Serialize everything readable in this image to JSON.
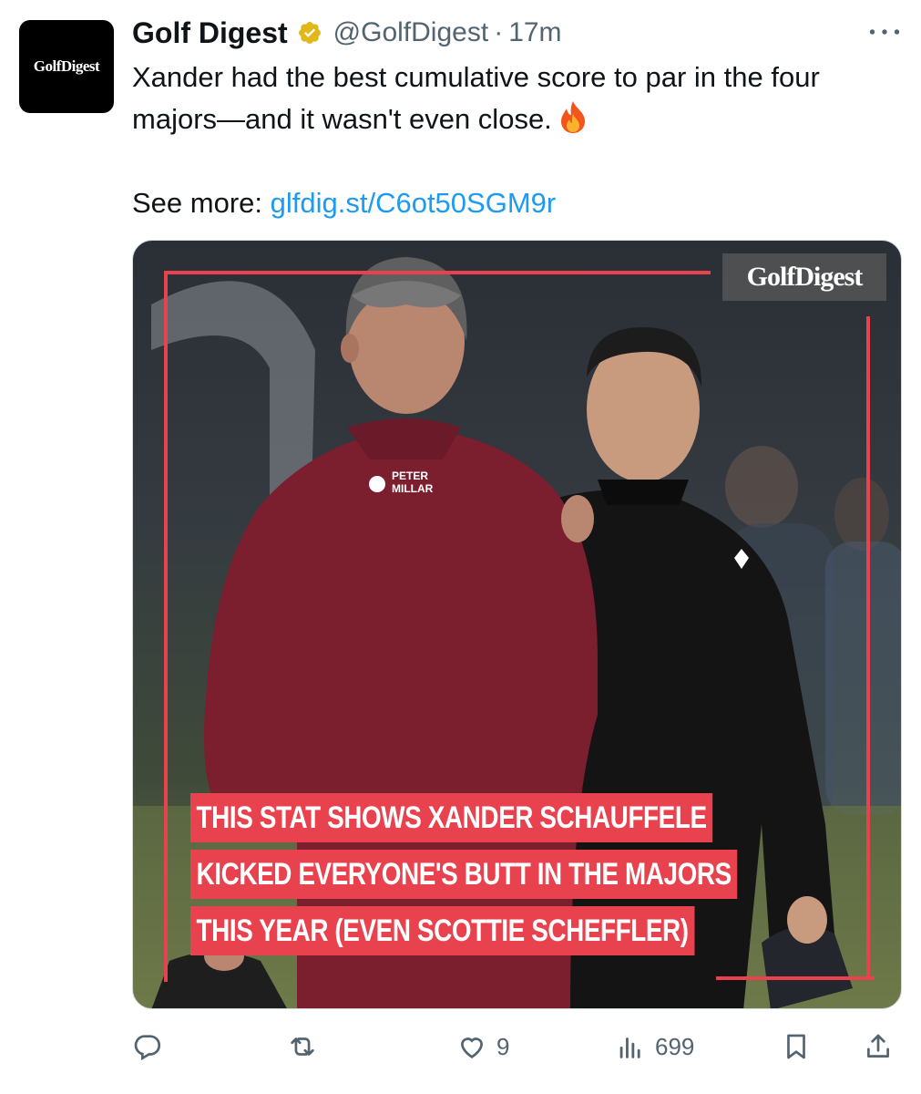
{
  "account": {
    "display_name": "Golf Digest",
    "handle": "@GolfDigest",
    "separator": "·",
    "time": "17m",
    "avatar_text": "GolfDigest"
  },
  "tweet": {
    "line1": "Xander had the best cumulative score to par in the four majors—and it wasn't even close.",
    "see_more_label": "See more: ",
    "link": "glfdig.st/C6ot50SGM9r"
  },
  "media": {
    "watermark": "GolfDigest",
    "shirt_brand": "PETER MILLAR",
    "headline": [
      "THIS STAT SHOWS XANDER SCHAUFFELE",
      "KICKED EVERYONE'S BUTT IN THE MAJORS",
      "THIS YEAR (EVEN SCOTTIE SCHEFFLER)"
    ]
  },
  "actions": {
    "likes": "9",
    "views": "699"
  },
  "colors": {
    "accent": "#1d9bf0",
    "muted": "#536471",
    "headline_bg": "#e8424e",
    "verified": "#e2b719"
  },
  "icons": [
    "verified-badge-icon",
    "more-icon",
    "fire-emoji-icon",
    "reply-icon",
    "repost-icon",
    "like-icon",
    "views-icon",
    "bookmark-icon",
    "share-icon"
  ]
}
